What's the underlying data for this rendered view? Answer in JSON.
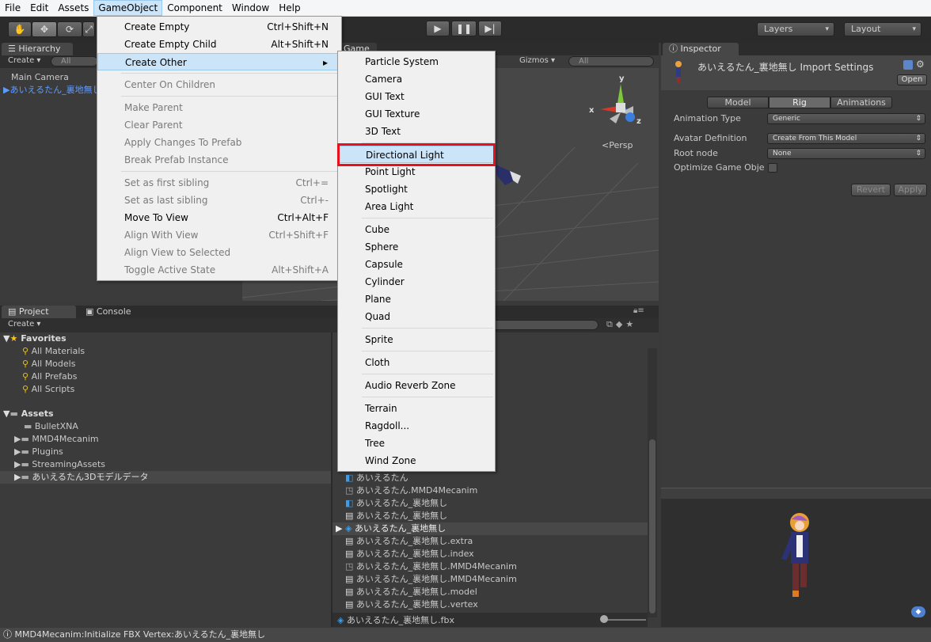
{
  "menubar": {
    "items": [
      "File",
      "Edit",
      "Assets",
      "GameObject",
      "Component",
      "Window",
      "Help"
    ]
  },
  "toolbar": {
    "layers_label": "Layers",
    "layout_label": "Layout"
  },
  "hierarchy": {
    "tab_label": "Hierarchy",
    "create_label": "Create",
    "search_placeholder": "All",
    "items": [
      "Main Camera",
      "あいえるたん_裏地無し"
    ]
  },
  "scene": {
    "tab_label": "Game",
    "gizmos_label": "Gizmos",
    "search_placeholder": "All",
    "persp_label": "Persp",
    "axis_y": "y",
    "axis_x": "x",
    "axis_z": "z"
  },
  "inspector": {
    "tab_label": "Inspector",
    "title": "あいえるたん_裏地無し Import Settings",
    "open_label": "Open",
    "tabs": [
      "Model",
      "Rig",
      "Animations"
    ],
    "fields": [
      {
        "label": "Animation Type",
        "value": "Generic"
      },
      {
        "label": "Avatar Definition",
        "value": "Create From This Model"
      },
      {
        "label": "Root node",
        "value": "None"
      },
      {
        "label": "Optimize Game Obje",
        "value": ""
      }
    ],
    "revert_label": "Revert",
    "apply_label": "Apply"
  },
  "project": {
    "tab_label": "Project",
    "console_label": "Console",
    "create_label": "Create",
    "favorites_label": "Favorites",
    "favorites": [
      "All Materials",
      "All Models",
      "All Prefabs",
      "All Scripts"
    ],
    "assets_label": "Assets",
    "folders": [
      "BulletXNA",
      "MMD4Mecanim",
      "Plugins",
      "StreamingAssets",
      "あいえるたん3Dモデルデータ"
    ],
    "files": [
      "あいえるたん",
      "あいえるたん.MMD4Mecanim",
      "あいえるたん_裏地無し",
      "あいえるたん_裏地無し",
      "あいえるたん_裏地無し",
      "あいえるたん_裏地無し.extra",
      "あいえるたん_裏地無し.index",
      "あいえるたん_裏地無し.MMD4Mecanim",
      "あいえるたん_裏地無し.MMD4Mecanim",
      "あいえるたん_裏地無し.model",
      "あいえるたん_裏地無し.vertex"
    ],
    "footer_file": "あいえるたん_裏地無し.fbx"
  },
  "gameobject_menu": {
    "items": [
      {
        "label": "Create Empty",
        "shortcut": "Ctrl+Shift+N",
        "disabled": false
      },
      {
        "label": "Create Empty Child",
        "shortcut": "Alt+Shift+N",
        "disabled": false
      },
      {
        "label": "Create Other",
        "shortcut": "",
        "disabled": false
      },
      {
        "label": "Center On Children",
        "shortcut": "",
        "disabled": true
      },
      {
        "label": "Make Parent",
        "shortcut": "",
        "disabled": true
      },
      {
        "label": "Clear Parent",
        "shortcut": "",
        "disabled": true
      },
      {
        "label": "Apply Changes To Prefab",
        "shortcut": "",
        "disabled": true
      },
      {
        "label": "Break Prefab Instance",
        "shortcut": "",
        "disabled": true
      },
      {
        "label": "Set as first sibling",
        "shortcut": "Ctrl+=",
        "disabled": true
      },
      {
        "label": "Set as last sibling",
        "shortcut": "Ctrl+-",
        "disabled": true
      },
      {
        "label": "Move To View",
        "shortcut": "Ctrl+Alt+F",
        "disabled": false
      },
      {
        "label": "Align With View",
        "shortcut": "Ctrl+Shift+F",
        "disabled": true
      },
      {
        "label": "Align View to Selected",
        "shortcut": "",
        "disabled": true
      },
      {
        "label": "Toggle Active State",
        "shortcut": "Alt+Shift+A",
        "disabled": true
      }
    ]
  },
  "create_other_menu": {
    "items": [
      "Particle System",
      "Camera",
      "GUI Text",
      "GUI Texture",
      "3D Text",
      "Directional Light",
      "Point Light",
      "Spotlight",
      "Area Light",
      "Cube",
      "Sphere",
      "Capsule",
      "Cylinder",
      "Plane",
      "Quad",
      "Sprite",
      "Cloth",
      "Audio Reverb Zone",
      "Terrain",
      "Ragdoll...",
      "Tree",
      "Wind Zone"
    ]
  },
  "status": {
    "message": "MMD4Mecanim:Initialize FBX Vertex:あいえるたん_裏地無し"
  },
  "colors": {
    "highlight_box": "#e8101a",
    "menu_highlight": "#cce4f7",
    "selected_item": "#4f8ef7"
  }
}
